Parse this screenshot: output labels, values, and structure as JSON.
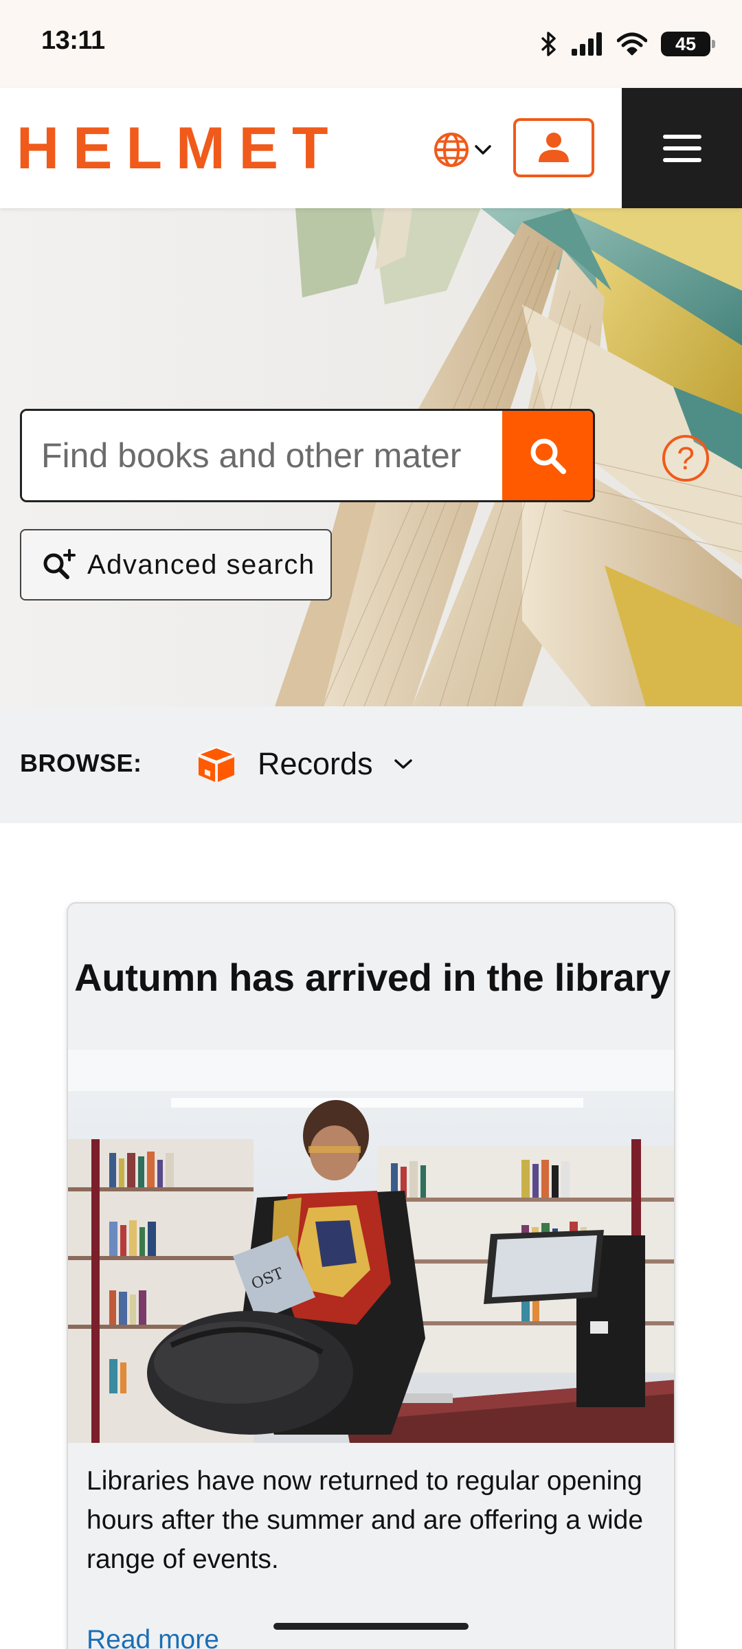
{
  "status_bar": {
    "time": "13:11",
    "battery": "45",
    "icons": [
      "bluetooth-icon",
      "signal-icon",
      "wifi-icon",
      "battery-icon"
    ]
  },
  "header": {
    "logo": "HELMET",
    "icons": [
      "globe-icon",
      "chevron-down-icon",
      "user-icon",
      "hamburger-menu-icon"
    ],
    "brand_color": "#f05a1a"
  },
  "search": {
    "placeholder": "Find books and other mater",
    "value": "",
    "button_icon": "search-icon",
    "help_icon": "help-circle-icon",
    "advanced_label": "Advanced search",
    "advanced_icon": "search-plus-icon",
    "accent_color": "#ff5a00"
  },
  "browse": {
    "label": "BROWSE:",
    "selected": "Records",
    "icon": "box-icon"
  },
  "card": {
    "title": "Autumn has arrived in the library",
    "text": "Libraries have now returned to regular opening hours after the summer and are offering a wide range of events.",
    "link": "Read more",
    "link_color": "#1a6fb5"
  }
}
